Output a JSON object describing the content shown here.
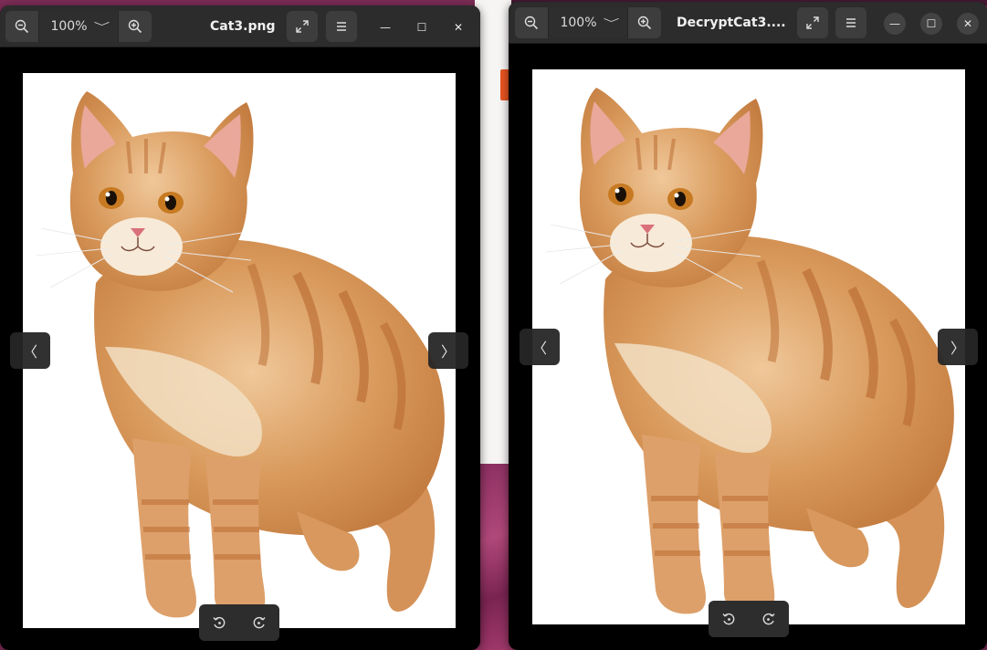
{
  "left_window": {
    "title": "Cat3.png",
    "zoom": "100%",
    "zoom_chevron": "﹀",
    "prev_glyph": "〈",
    "next_glyph": "〉",
    "maximize_glyph": "☐",
    "minimize_glyph": "—",
    "close_glyph": "✕"
  },
  "right_window": {
    "title": "DecryptCat3....",
    "zoom": "100%",
    "zoom_chevron": "﹀",
    "prev_glyph": "〈",
    "next_glyph": "〉",
    "maximize_glyph": "☐",
    "minimize_glyph": "—",
    "close_glyph": "✕"
  },
  "colors": {
    "headerbar": "#2c2c2c",
    "button": "#3d3d3d",
    "accent_orange": "#e95420",
    "desktop": "#7d2d57"
  },
  "icons": [
    "zoom-out-icon",
    "zoom-in-icon",
    "fullscreen-icon",
    "menu-icon",
    "minimize-icon",
    "maximize-icon",
    "close-icon",
    "previous-icon",
    "next-icon",
    "rotate-left-icon",
    "rotate-right-icon"
  ]
}
